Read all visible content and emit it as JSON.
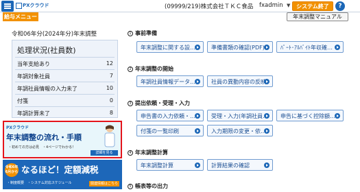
{
  "header": {
    "logo_text": "PXクラウド",
    "company": "(09999/219)株式会社ＴＫＣ食品",
    "user": "fxadmin",
    "user_caret": "▼",
    "system_end_label": "システム終了",
    "help_label": "?"
  },
  "subbar": {
    "menu_tab_label": "給与メニュー",
    "manual_label": "年末調整マニュアル"
  },
  "left": {
    "period_title": "令和06年分(2024年分)年末調整",
    "status_title": "処理状況(社員数)",
    "status_rows": [
      {
        "label": "当年支給あり",
        "value": "12"
      },
      {
        "label": "年調対象社員",
        "value": "7"
      },
      {
        "label": "年調社員情報の入力未了",
        "value": "10"
      },
      {
        "label": "付箋",
        "value": "0"
      },
      {
        "label": "年調計算未了",
        "value": "8"
      }
    ]
  },
  "banner1": {
    "brand": "PXクラウド",
    "title": "年末調整の流れ・手順",
    "subtitle": "・初めての方は必見　・4ページでわかる！",
    "button": "詳細を見る"
  },
  "banner2": {
    "tag": "令和6年6月から",
    "title": "なるほど！定額減税",
    "items": "・制度概要　・システム対応スケジュール",
    "button": "関連情報はこちら"
  },
  "sections": [
    {
      "num": "1",
      "title": "事前準備",
      "actions": [
        "年末調整に関する設…",
        "準備書類の確認(PDF)",
        "ﾊﾟｰﾄ･ｱﾙﾊﾞｲﾄ年収確…"
      ]
    },
    {
      "num": "2",
      "title": "年末調整の開始",
      "actions": [
        "年調社員情報データ…",
        "社員の異動内容の反映"
      ]
    },
    {
      "num": "3",
      "title": "提出依頼・受理・入力",
      "actions": [
        "申告書の入力依頼・…",
        "受理・入力(年調社員…",
        "申告に基づく控除額…",
        "付箋の一覧印刷",
        "入力期限の変更・依…"
      ]
    },
    {
      "num": "4",
      "title": "年末調整計算",
      "actions": [
        "年末調整計算",
        "計算結果の確認"
      ]
    },
    {
      "num": "5",
      "title": "帳表等の出力",
      "actions": []
    }
  ]
}
